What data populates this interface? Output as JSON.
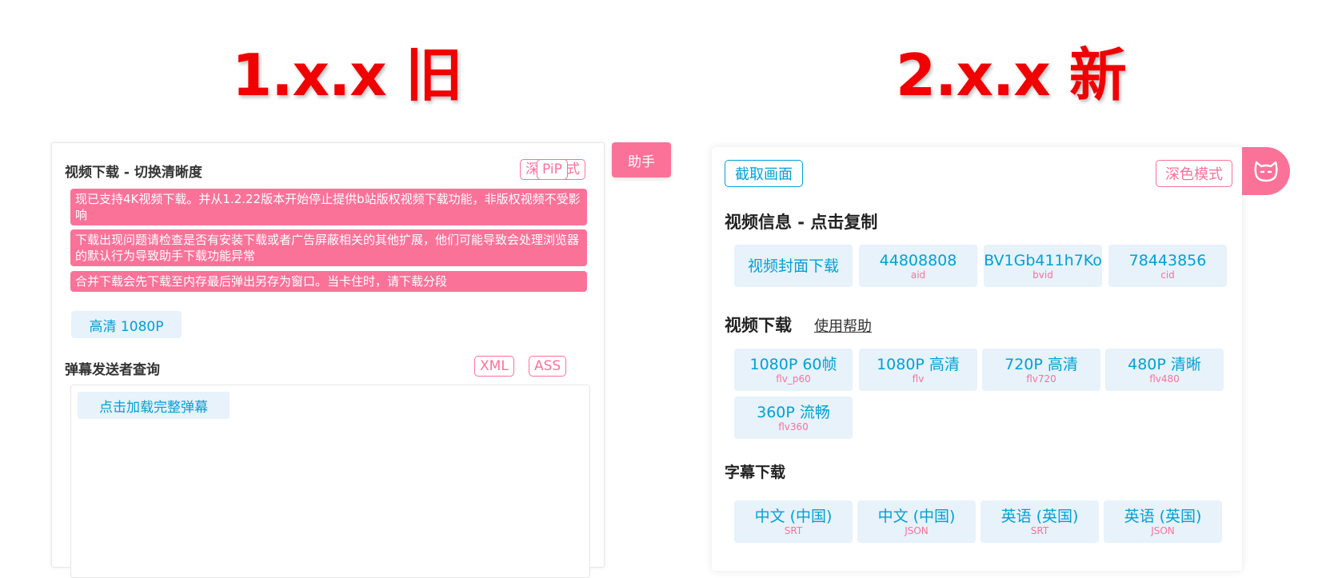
{
  "titles": {
    "old": "1.x.x 旧",
    "new": "2.x.x 新"
  },
  "old": {
    "header": "视频下载 - 切换清晰度",
    "dark_mode": "深色模式",
    "pip": "PiP",
    "notices": [
      "现已支持4K视频下载。并从1.2.22版本开始停止提供b站版权视频下载功能，非版权视频不受影响",
      "下载出现问题请检查是否有安装下载或者广告屏蔽相关的其他扩展，他们可能导致会处理浏览器的默认行为导致助手下载功能异常",
      "合并下载会先下载至内存最后弹出另存为窗口。当卡住时，请下载分段"
    ],
    "quality": "高清 1080P",
    "danmaku_header": "弹幕发送者查询",
    "xml": "XML",
    "ass": "ASS",
    "load_danmaku": "点击加载完整弹幕",
    "helper": "助手"
  },
  "new": {
    "capture": "截取画面",
    "dark_mode": "深色模式",
    "info_title": "视频信息 - 点击复制",
    "info": [
      {
        "main": "视频封面下载",
        "sub": ""
      },
      {
        "main": "44808808",
        "sub": "aid"
      },
      {
        "main": "BV1Gb411h7Ko",
        "sub": "bvid"
      },
      {
        "main": "78443856",
        "sub": "cid"
      }
    ],
    "download_title": "视频下载",
    "help_link": "使用帮助",
    "downloads": [
      {
        "main": "1080P 60帧",
        "sub": "flv_p60"
      },
      {
        "main": "1080P 高清",
        "sub": "flv"
      },
      {
        "main": "720P 高清",
        "sub": "flv720"
      },
      {
        "main": "480P 清晰",
        "sub": "flv480"
      },
      {
        "main": "360P 流畅",
        "sub": "flv360"
      }
    ],
    "subtitle_title": "字幕下载",
    "subtitles": [
      {
        "main": "中文 (中国)",
        "sub": "SRT"
      },
      {
        "main": "中文 (中国)",
        "sub": "JSON"
      },
      {
        "main": "英语 (英国)",
        "sub": "SRT"
      },
      {
        "main": "英语 (英国)",
        "sub": "JSON"
      }
    ]
  },
  "colors": {
    "accent_pink": "#fb7299",
    "accent_blue": "#00a1d6",
    "tile_bg": "#e7f2fb",
    "title_red": "#f00000"
  }
}
